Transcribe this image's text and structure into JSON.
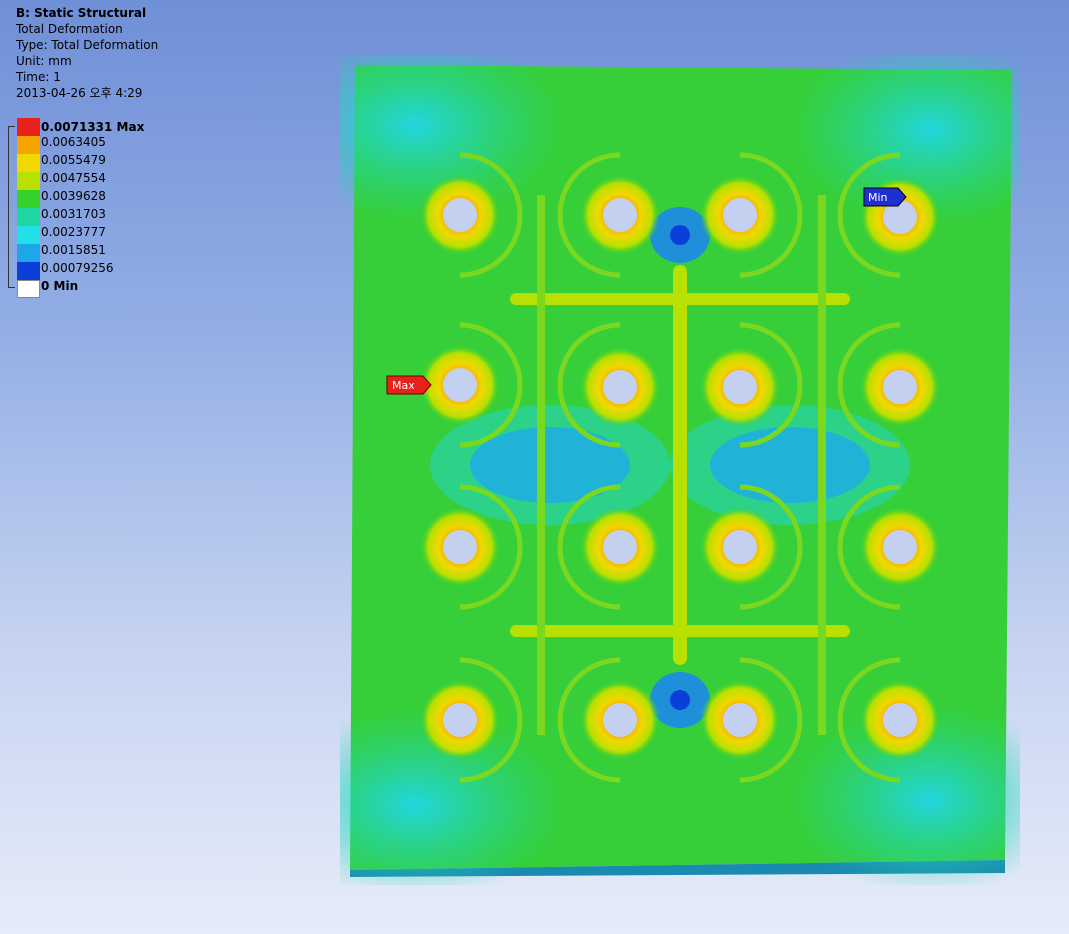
{
  "header": {
    "title": "B: Static Structural",
    "line1": "Total Deformation",
    "line2": "Type: Total Deformation",
    "line3": "Unit: mm",
    "line4": "Time: 1",
    "line5": "2013-04-26 오후 4:29"
  },
  "legend": {
    "items": [
      {
        "label": "0.0071331 Max",
        "color": "#e8221a",
        "bold": true
      },
      {
        "label": "0.0063405",
        "color": "#f5a300",
        "bold": false
      },
      {
        "label": "0.0055479",
        "color": "#f0d800",
        "bold": false
      },
      {
        "label": "0.0047554",
        "color": "#b8e000",
        "bold": false
      },
      {
        "label": "0.0039628",
        "color": "#36d12a",
        "bold": false
      },
      {
        "label": "0.0031703",
        "color": "#20d6a0",
        "bold": false
      },
      {
        "label": "0.0023777",
        "color": "#22e0e8",
        "bold": false
      },
      {
        "label": "0.0015851",
        "color": "#1ea6e8",
        "bold": false
      },
      {
        "label": "0.00079256",
        "color": "#0a3fd8",
        "bold": false
      },
      {
        "label": "0 Min",
        "color": "#ffffff",
        "bold": true
      }
    ]
  },
  "probes": {
    "max_label": "Max",
    "min_label": "Min",
    "max_color": "#e8221a",
    "min_color": "#1f2fd0"
  }
}
